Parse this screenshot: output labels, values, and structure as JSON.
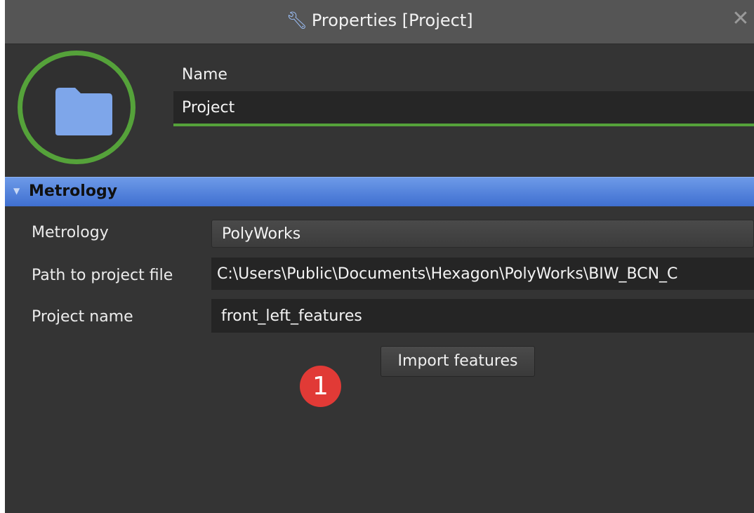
{
  "window": {
    "title": "Properties [Project]",
    "title_icon": "wrench-icon",
    "close_glyph": "✕"
  },
  "header": {
    "avatar_icon": "folder-icon",
    "accent_color": "#55a23a",
    "name_label": "Name",
    "name_value": "Project"
  },
  "section": {
    "title": "Metrology",
    "expanded": true,
    "color": "#5584dd"
  },
  "fields": {
    "metrology_label": "Metrology",
    "metrology_value": "PolyWorks",
    "path_label": "Path to project file",
    "path_value": "C:\\Users\\Public\\Documents\\Hexagon\\PolyWorks\\BIW_BCN_C",
    "project_name_label": "Project name",
    "project_name_value": "front_left_features"
  },
  "actions": {
    "import_label": "Import features"
  },
  "callout": {
    "number": "1",
    "color": "#e13a36"
  }
}
